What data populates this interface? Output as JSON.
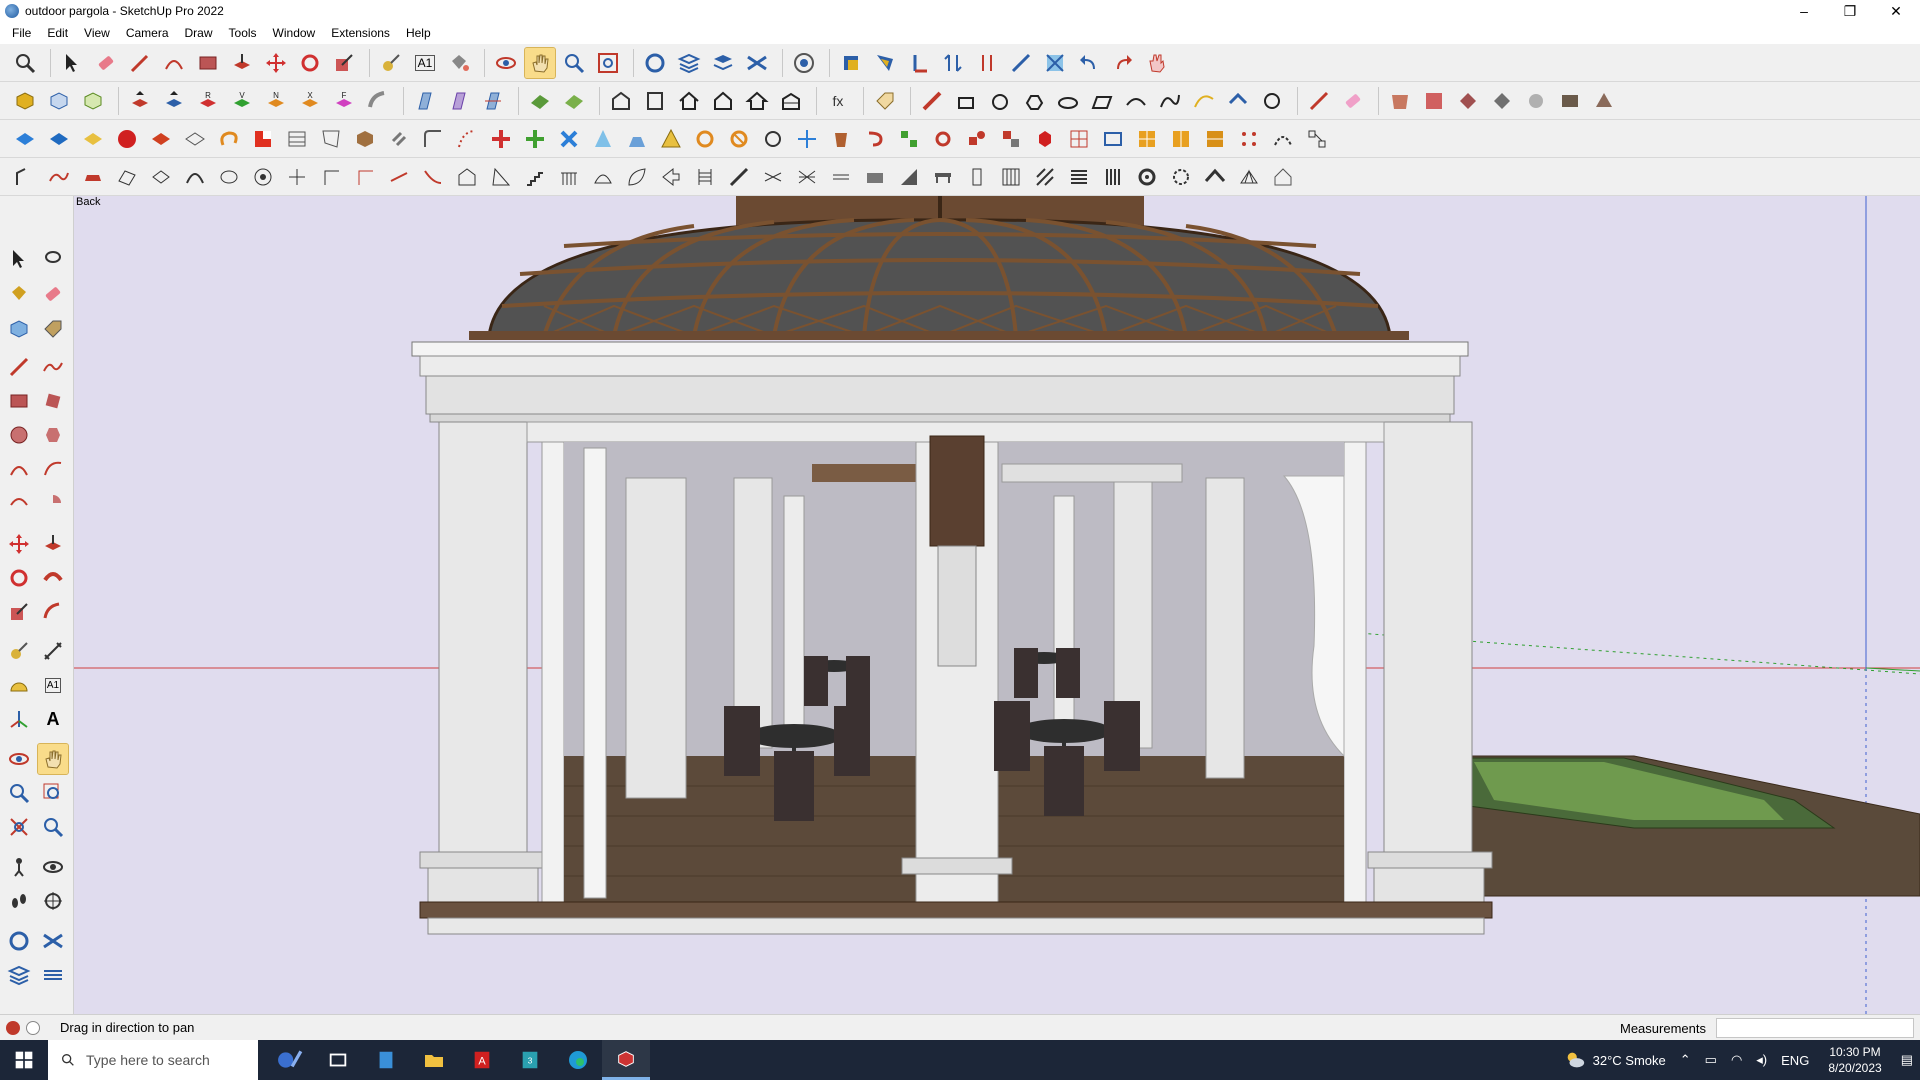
{
  "window": {
    "title": "outdoor pargola - SketchUp Pro 2022",
    "minimize": "–",
    "maximize": "❐",
    "close": "✕"
  },
  "menu": [
    "File",
    "Edit",
    "View",
    "Camera",
    "Draw",
    "Tools",
    "Window",
    "Extensions",
    "Help"
  ],
  "viewport": {
    "scene_label": "Back",
    "background_color": "#e0dcee"
  },
  "status": {
    "hint": "Drag in direction to pan",
    "measurements_label": "Measurements",
    "measurements_value": ""
  },
  "taskbar": {
    "search_placeholder": "Type here to search",
    "weather": "32°C  Smoke",
    "language": "ENG",
    "time": "10:30 PM",
    "date": "8/20/2023"
  },
  "colors": {
    "accent": "#f9dc8a",
    "taskbar": "#1c2638"
  }
}
